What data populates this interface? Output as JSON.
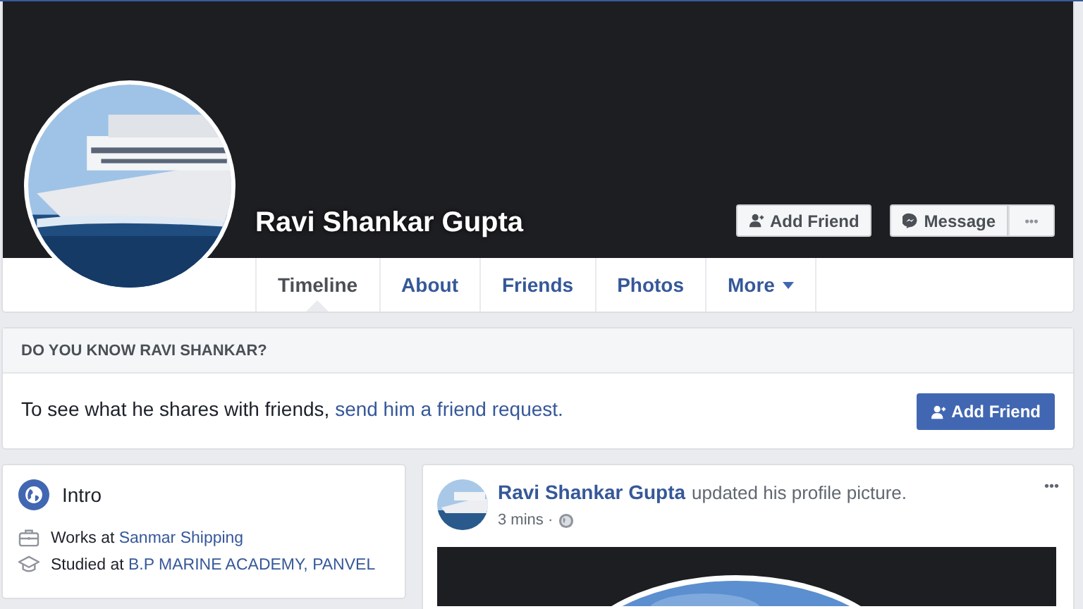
{
  "profile": {
    "name": "Ravi Shankar Gupta"
  },
  "cover_actions": [
    {
      "label": "Add Friend",
      "kind": "add-friend"
    },
    {
      "label": "Message",
      "kind": "message"
    },
    {
      "label": "•••",
      "kind": "more"
    }
  ],
  "tabs": [
    {
      "label": "Timeline",
      "selected": true,
      "dropdown": false
    },
    {
      "label": "About",
      "selected": false,
      "dropdown": false
    },
    {
      "label": "Friends",
      "selected": false,
      "dropdown": false
    },
    {
      "label": "Photos",
      "selected": false,
      "dropdown": false
    },
    {
      "label": "More",
      "selected": false,
      "dropdown": true
    }
  ],
  "know_card": {
    "title": "DO YOU KNOW RAVI SHANKAR?",
    "text": "To see what he shares with friends,",
    "link": "send him a friend request.",
    "button": "Add Friend"
  },
  "intro": {
    "title": "Intro",
    "items": [
      {
        "kind": "work",
        "text": "Works at",
        "link": "Sanmar Shipping"
      },
      {
        "kind": "education",
        "text": "Studied at",
        "link": "B.P MARINE ACADEMY, PANVEL"
      }
    ]
  },
  "post": {
    "author": "Ravi Shankar Gupta",
    "action": "updated his profile picture.",
    "time": "3 mins ·",
    "menu": "•••"
  }
}
